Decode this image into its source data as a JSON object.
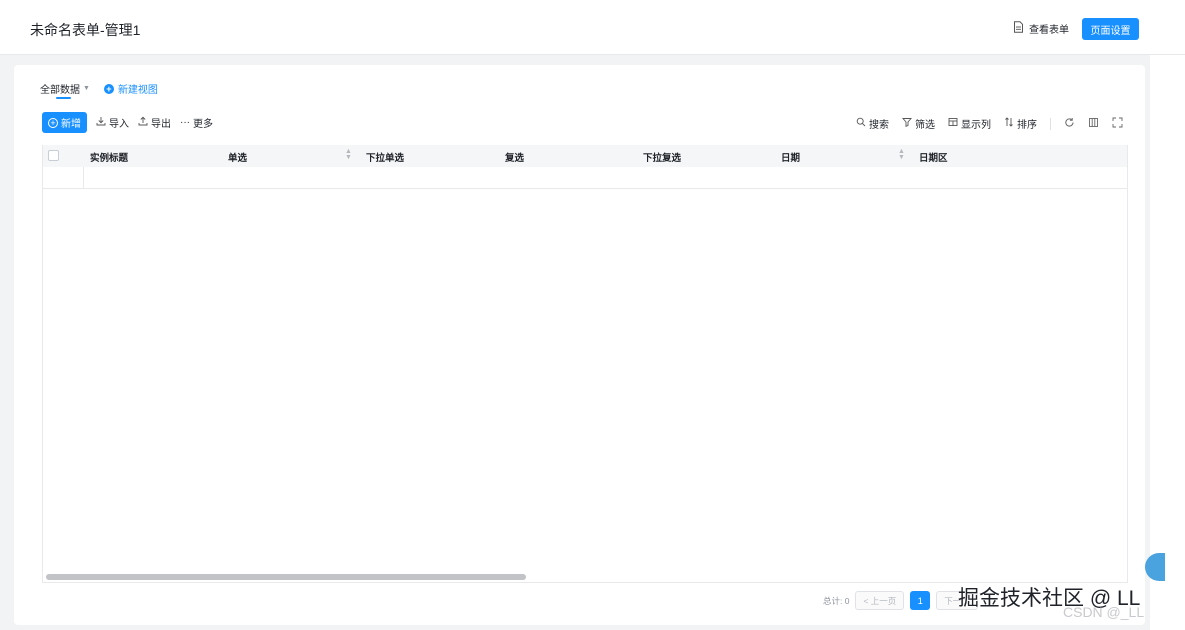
{
  "header": {
    "title": "未命名表单-管理1",
    "view_form_label": "查看表单",
    "page_settings_label": "页面设置"
  },
  "views": {
    "all_data_label": "全部数据",
    "new_view_label": "新建视图"
  },
  "toolbar": {
    "add_label": "新增",
    "import_label": "导入",
    "export_label": "导出",
    "more_label": "更多",
    "search_label": "搜索",
    "filter_label": "筛选",
    "columns_label": "显示列",
    "sort_label": "排序"
  },
  "table": {
    "columns": [
      "实例标题",
      "单选",
      "下拉单选",
      "复选",
      "下拉复选",
      "日期",
      "日期区"
    ]
  },
  "pagination": {
    "total_label": "总计: 0",
    "prev_label": "上一页",
    "current_page": "1",
    "next_label": "下一页"
  },
  "watermark": {
    "juejin": "掘金技术社区 @ LL",
    "csdn": "CSDN @_LL"
  },
  "colors": {
    "accent": "#1890ff",
    "canvas_bg": "#f2f3f5"
  }
}
